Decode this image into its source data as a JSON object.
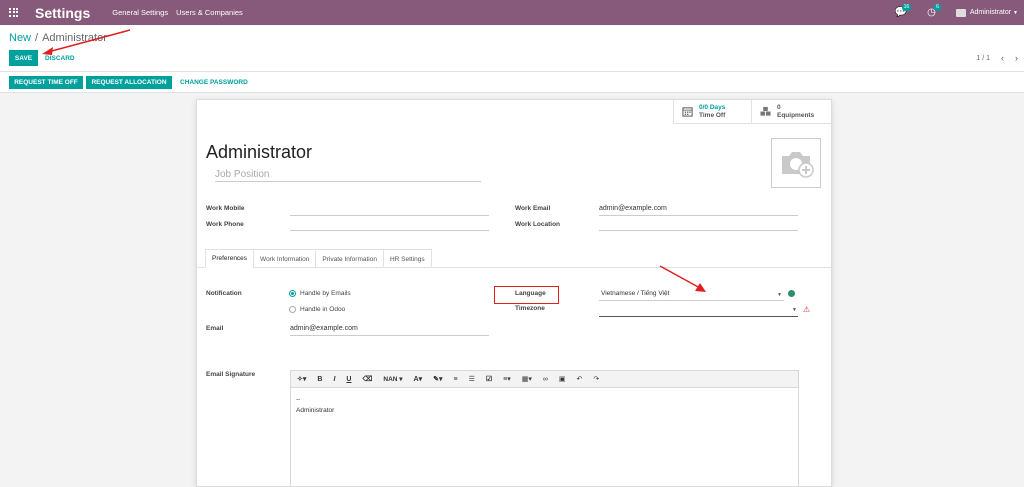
{
  "navbar": {
    "app_title": "Settings",
    "menu": [
      "General Settings",
      "Users & Companies"
    ],
    "messages_count": "16",
    "activities_count": "6",
    "user_name": "Administrator"
  },
  "control_panel": {
    "breadcrumb_parent": "New",
    "breadcrumb_current": "Administrator",
    "save_label": "SAVE",
    "discard_label": "DISCARD",
    "pager": "1 / 1"
  },
  "header_buttons": {
    "request_time_off": "REQUEST TIME OFF",
    "request_allocation": "REQUEST ALLOCATION",
    "change_password": "CHANGE PASSWORD"
  },
  "smart_buttons": {
    "time_off_value": "0/0 Days",
    "time_off_label": "Time Off",
    "equipment_value": "0",
    "equipment_label": "Equipments"
  },
  "employee": {
    "name": "Administrator",
    "job_position_placeholder": "Job Position"
  },
  "fields": {
    "work_mobile_label": "Work Mobile",
    "work_phone_label": "Work Phone",
    "work_email_label": "Work Email",
    "work_email_value": "admin@example.com",
    "work_location_label": "Work Location"
  },
  "tabs": [
    "Preferences",
    "Work Information",
    "Private Information",
    "HR Settings"
  ],
  "preferences": {
    "notification_label": "Notification",
    "notify_email": "Handle by Emails",
    "notify_odoo": "Handle in Odoo",
    "email_label": "Email",
    "email_value": "admin@example.com",
    "language_label": "Language",
    "language_value": "Vietnamese / Tiếng Việt",
    "timezone_label": "Timezone",
    "signature_label": "Email Signature",
    "font_size": "NAN",
    "signature_lines": [
      "--",
      "Administrator"
    ]
  },
  "colors": {
    "navbar": "#875a7b",
    "accent": "#00a09d",
    "annotation": "#e02020"
  }
}
